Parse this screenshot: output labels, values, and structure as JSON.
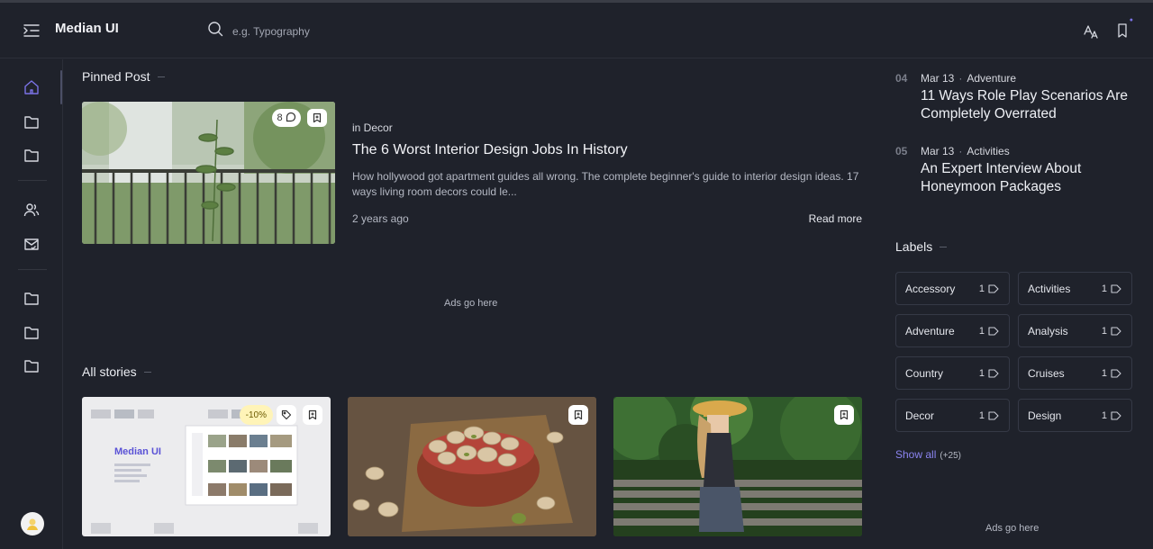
{
  "colors": {
    "background": "#1f222b",
    "accent": "#8b84f0",
    "border": "#353946"
  },
  "header": {
    "brand": "Median UI",
    "search_placeholder": "e.g. Typography",
    "icons": [
      "menu-collapse-icon",
      "search-icon",
      "translate-icon",
      "bookmark-icon"
    ]
  },
  "sidebar": {
    "items": [
      "home-icon",
      "folder-icon",
      "folder-icon",
      "users-icon",
      "mail-check-icon",
      "folder-icon",
      "folder-icon",
      "folder-icon"
    ]
  },
  "pinned": {
    "section_title": "Pinned Post",
    "comments": "8",
    "category": "in Decor",
    "title": "The 6 Worst Interior Design Jobs In History",
    "excerpt": "How hollywood got apartment guides all wrong. The complete beginner's guide to interior design ideas. 17 ways living room decors could le...",
    "time": "2 years ago",
    "read_more": "Read more"
  },
  "ads": {
    "main": "Ads go here",
    "side": "Ads go here"
  },
  "stories": {
    "section_title": "All stories",
    "discount": "-10%",
    "mock_brand": "Median UI"
  },
  "trending": [
    {
      "num": "04",
      "date": "Mar 13",
      "category": "Adventure",
      "title": "11 Ways Role Play Scenarios Are Completely Overrated"
    },
    {
      "num": "05",
      "date": "Mar 13",
      "category": "Activities",
      "title": "An Expert Interview About Honeymoon Packages"
    }
  ],
  "labels": {
    "section_title": "Labels",
    "items": [
      {
        "name": "Accessory",
        "count": "1"
      },
      {
        "name": "Activities",
        "count": "1"
      },
      {
        "name": "Adventure",
        "count": "1"
      },
      {
        "name": "Analysis",
        "count": "1"
      },
      {
        "name": "Country",
        "count": "1"
      },
      {
        "name": "Cruises",
        "count": "1"
      },
      {
        "name": "Decor",
        "count": "1"
      },
      {
        "name": "Design",
        "count": "1"
      }
    ],
    "show_all": "Show all",
    "show_all_count": "(+25)"
  }
}
